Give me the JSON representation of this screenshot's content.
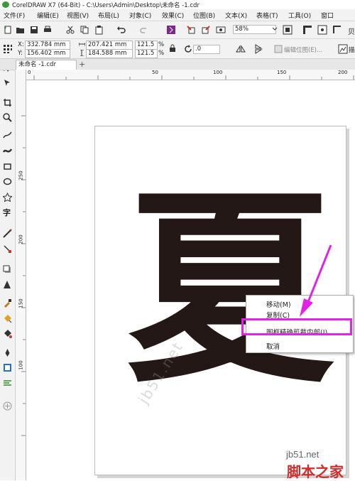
{
  "window": {
    "title": "CorelDRAW X7 (64-Bit) - C:\\Users\\Admin\\Desktop\\未命名 -1.cdr"
  },
  "menu": {
    "items": [
      "文件(F)",
      "编辑(E)",
      "视图(V)",
      "布局(L)",
      "对象(C)",
      "效果(C)",
      "位图(B)",
      "文本(X)",
      "表格(T)",
      "工具(O)",
      "窗口"
    ]
  },
  "toolbar": {
    "zoom": "58%"
  },
  "propbar": {
    "x_label": "X:",
    "x": "332.784 mm",
    "y_label": "Y:",
    "y": "156.402 mm",
    "w": "207.421 mm",
    "h": "184.588 mm",
    "sx": "121.5",
    "sy": "121.5",
    "pct1": "%",
    "pct2": "%",
    "angle": ".0",
    "edit_bitmap": "编辑位图(E)...",
    "trace": "描"
  },
  "tabs": {
    "doc": "未命名 -1.cdr",
    "add": "+"
  },
  "ruler": {
    "h_ticks": [
      "0",
      "50",
      "100",
      "150",
      "200"
    ],
    "v_ticks": [
      "250",
      "200",
      "150",
      "100"
    ]
  },
  "canvas": {
    "glyph": "夏",
    "watermark": "jb51.net"
  },
  "context_menu": {
    "items": [
      "移动(M)",
      "复制(C)",
      "图框精确剪裁内部(I)",
      "取消"
    ]
  },
  "brand": {
    "site": "jb51.net",
    "name": "脚本之家"
  },
  "colors": {
    "highlight": "#e023e6",
    "glyph": "#231815"
  }
}
